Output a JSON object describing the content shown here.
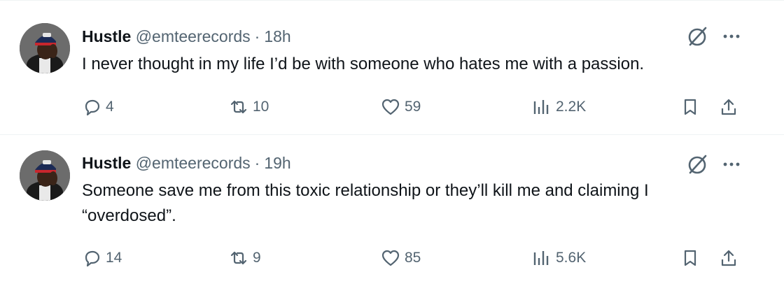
{
  "tweets": [
    {
      "name": "Hustle",
      "handle": "@emteerecords",
      "separator": "·",
      "time": "18h",
      "text": "I never thought in my life I’d be with someone who hates me with a passion.",
      "replies": "4",
      "retweets": "10",
      "likes": "59",
      "views": "2.2K"
    },
    {
      "name": "Hustle",
      "handle": "@emteerecords",
      "separator": "·",
      "time": "19h",
      "text": "Someone save me from this toxic relationship or they’ll kill me and claiming I “overdosed”.",
      "replies": "14",
      "retweets": "9",
      "likes": "85",
      "views": "5.6K"
    }
  ],
  "icons": {
    "reply": "reply-icon",
    "retweet": "retweet-icon",
    "like": "heart-icon",
    "views": "views-icon",
    "bookmark": "bookmark-icon",
    "share": "share-icon",
    "grok": "grok-icon",
    "more": "more-icon"
  },
  "colors": {
    "text": "#0f1419",
    "secondary": "#536471",
    "divider": "#eff3f4"
  }
}
